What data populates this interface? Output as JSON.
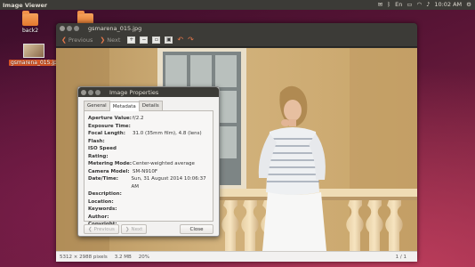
{
  "topbar": {
    "app_title": "Image Viewer",
    "clock": "10:02 AM",
    "brightness_label": "En"
  },
  "desktop": {
    "icons": [
      {
        "label": "back2"
      },
      {
        "label": ""
      },
      {
        "label": "gsmarena_015.jpg"
      }
    ]
  },
  "viewer": {
    "window_title": "gsmarena_015.jpg",
    "toolbar": {
      "previous_label": "Previous",
      "next_label": "Next"
    },
    "status": {
      "dimensions": "5312 × 2988 pixels",
      "size": "3.2 MB",
      "zoom": "20%",
      "page": "1 / 1"
    }
  },
  "dialog": {
    "title": "Image Properties",
    "tabs": [
      {
        "label": "General",
        "active": false
      },
      {
        "label": "Metadata",
        "active": true
      },
      {
        "label": "Details",
        "active": false
      }
    ],
    "fields": [
      {
        "key": "Aperture Value:",
        "value": "f/2.2"
      },
      {
        "key": "Exposure Time:",
        "value": ""
      },
      {
        "key": "Focal Length:",
        "value": "31.0 (35mm film), 4.8 (lens)"
      },
      {
        "key": "Flash:",
        "value": ""
      },
      {
        "key": "ISO Speed Rating:",
        "value": ""
      },
      {
        "key": "Metering Mode:",
        "value": "Center-weighted average"
      },
      {
        "key": "Camera Model:",
        "value": "SM-N910F"
      },
      {
        "key": "Date/Time:",
        "value": "Sun, 31 August 2014  10:06:37 AM"
      },
      {
        "key": "Description:",
        "value": ""
      },
      {
        "key": "Location:",
        "value": ""
      },
      {
        "key": "Keywords:",
        "value": ""
      },
      {
        "key": "Author:",
        "value": ""
      },
      {
        "key": "Copyright:",
        "value": ""
      }
    ],
    "buttons": {
      "previous": "Previous",
      "next": "Next",
      "close": "Close"
    }
  }
}
